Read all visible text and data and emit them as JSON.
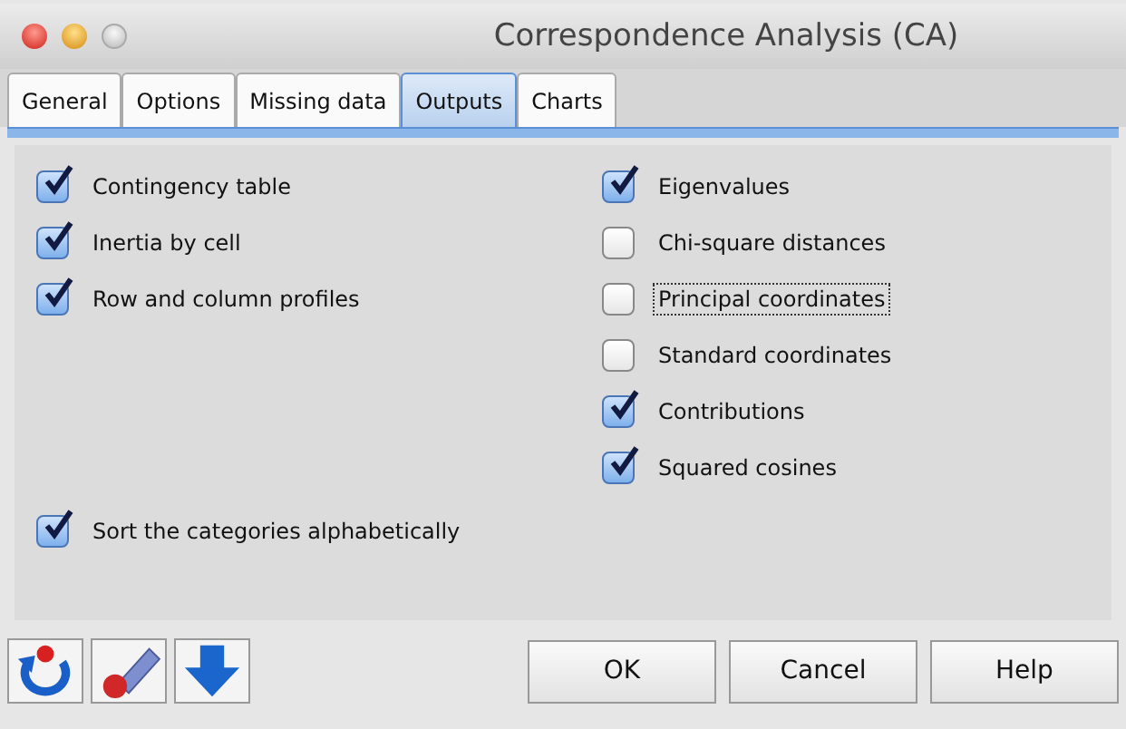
{
  "window": {
    "title": "Correspondence Analysis (CA)"
  },
  "tabs": [
    {
      "label": "General",
      "selected": false
    },
    {
      "label": "Options",
      "selected": false
    },
    {
      "label": "Missing data",
      "selected": false
    },
    {
      "label": "Outputs",
      "selected": true
    },
    {
      "label": "Charts",
      "selected": false
    }
  ],
  "left_options": [
    {
      "label": "Contingency table",
      "checked": true,
      "focused": false
    },
    {
      "label": "Inertia by cell",
      "checked": true,
      "focused": false
    },
    {
      "label": "Row and column profiles",
      "checked": true,
      "focused": false
    }
  ],
  "right_options": [
    {
      "label": "Eigenvalues",
      "checked": true,
      "focused": false
    },
    {
      "label": "Chi-square distances",
      "checked": false,
      "focused": false
    },
    {
      "label": "Principal coordinates",
      "checked": false,
      "focused": true
    },
    {
      "label": "Standard coordinates",
      "checked": false,
      "focused": false
    },
    {
      "label": "Contributions",
      "checked": true,
      "focused": false
    },
    {
      "label": "Squared cosines",
      "checked": true,
      "focused": false
    }
  ],
  "bottom_option": {
    "label": "Sort the categories alphabetically",
    "checked": true,
    "focused": false
  },
  "buttons": [
    "OK",
    "Cancel",
    "Help"
  ]
}
